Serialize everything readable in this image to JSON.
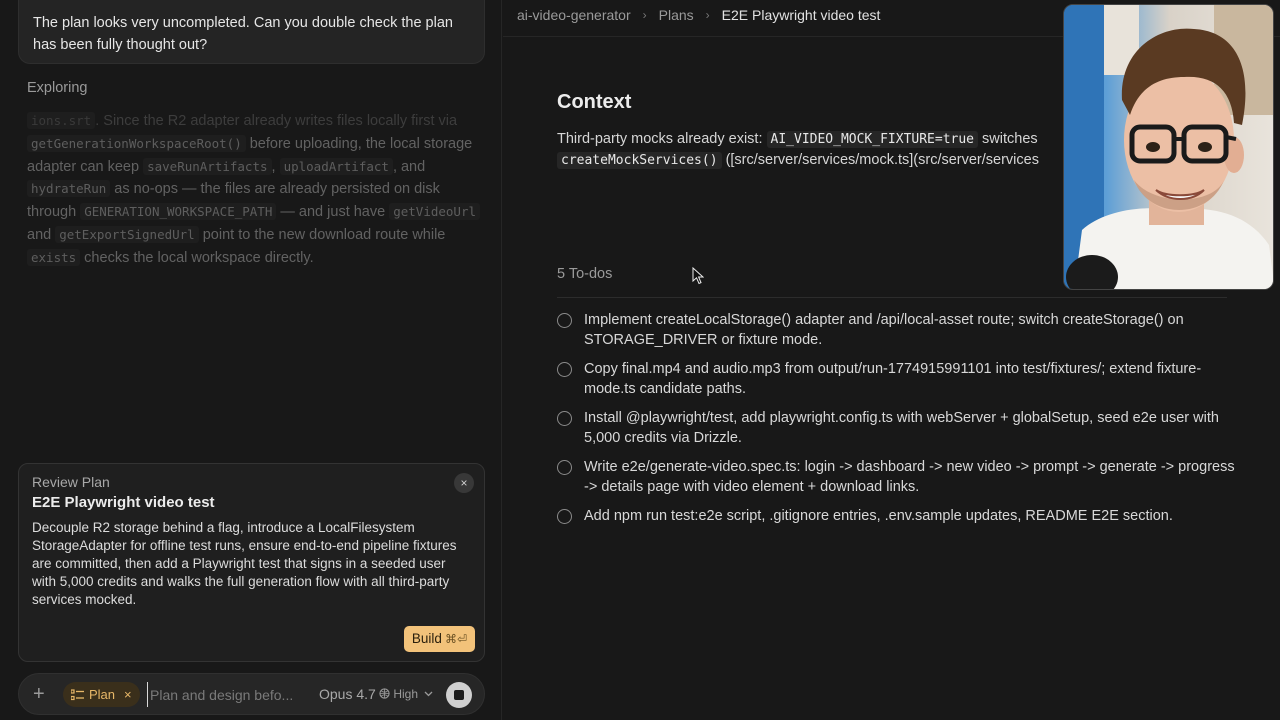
{
  "chat": {
    "user_message": "The plan looks very uncompleted. Can you double check the plan has been fully thought out?",
    "status": "Exploring",
    "faded": {
      "f1": "ions.srt",
      "t1": ". Since the R2 adapter already writes files locally first via",
      "c1": "getGenerationWorkspaceRoot()",
      "t2": " before uploading, the local storage adapter can keep ",
      "c2": "saveRunArtifacts",
      "t3": ", ",
      "c3": "uploadArtifact",
      "t4": ", and ",
      "c4": "hydrateRun",
      "t5": " as no-ops — the files are already persisted on disk through ",
      "c5": "GENERATION_WORKSPACE_PATH",
      "t6": " — and just have ",
      "c6": "getVideoUrl",
      "t7": " and ",
      "c7": "getExportSignedUrl",
      "t8": " point to the new download route while ",
      "c8": "exists",
      "t9": " checks the local workspace directly."
    }
  },
  "review": {
    "label": "Review Plan",
    "title": "E2E Playwright video test",
    "description": "Decouple R2 storage behind a flag, introduce a LocalFilesystem StorageAdapter for offline test runs, ensure end-to-end pipeline fixtures are committed, then add a Playwright test that signs in a seeded user with 5,000 credits and walks the full generation flow with all third-party services mocked.",
    "close_icon": "×",
    "build_label": "Build",
    "build_shortcut": "⌘⏎"
  },
  "composer": {
    "plus_icon": "+",
    "mode_label": "Plan",
    "mode_remove_icon": "×",
    "placeholder": "Plan and design befo...",
    "model": "Opus 4.7",
    "effort": "High"
  },
  "breadcrumb": {
    "project": "ai-video-generator",
    "section": "Plans",
    "current": "E2E Playwright video test",
    "separator": "›"
  },
  "context": {
    "heading": "Context",
    "p1": "Third-party mocks already exist: ",
    "env_var": "AI_VIDEO_MOCK_FIXTURE=true",
    "p2": " switches",
    "fn": "createMockServices()",
    "p3": " ([src/server/services/mock.ts](src/server/services"
  },
  "todos": {
    "header": "5 To-dos",
    "items": [
      "Implement createLocalStorage() adapter and /api/local-asset route; switch createStorage() on STORAGE_DRIVER or fixture mode.",
      "Copy final.mp4 and audio.mp3 from output/run-1774915991101 into test/fixtures/; extend fixture-mode.ts candidate paths.",
      "Install @playwright/test, add playwright.config.ts with webServer + globalSetup, seed e2e user with 5,000 credits via Drizzle.",
      "Write e2e/generate-video.spec.ts: login -> dashboard -> new video -> prompt -> generate -> progress -> details page with video element + download links.",
      "Add npm run test:e2e script, .gitignore entries, .env.sample updates, README E2E section."
    ]
  }
}
